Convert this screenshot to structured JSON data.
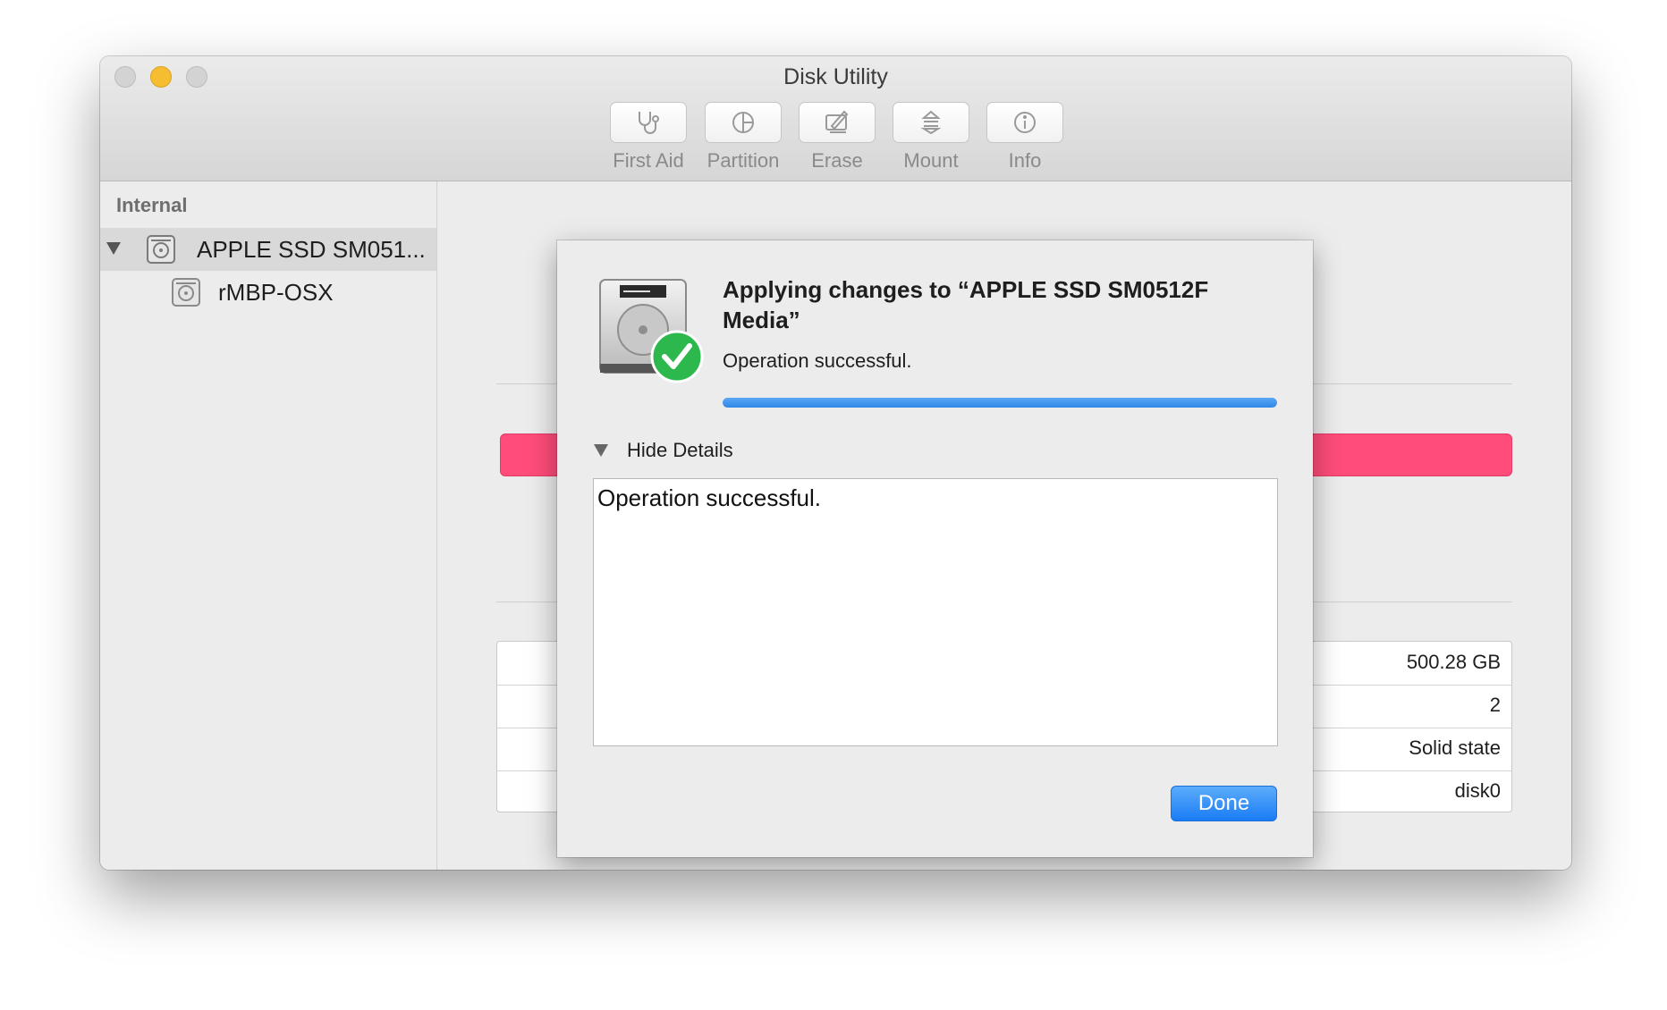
{
  "window": {
    "title": "Disk Utility"
  },
  "toolbar": {
    "items": [
      {
        "label": "First Aid",
        "icon": "stethoscope-icon"
      },
      {
        "label": "Partition",
        "icon": "pie-chart-icon"
      },
      {
        "label": "Erase",
        "icon": "erase-icon"
      },
      {
        "label": "Mount",
        "icon": "mount-icon"
      },
      {
        "label": "Info",
        "icon": "info-icon"
      }
    ]
  },
  "sidebar": {
    "section": "Internal",
    "items": [
      {
        "label": "APPLE SSD SM051...",
        "icon": "hard-drive-icon",
        "selected": true
      },
      {
        "label": "rMBP-OSX",
        "icon": "volume-icon",
        "selected": false
      }
    ]
  },
  "main": {
    "usage_bar_color": "#ff4c7a",
    "info_values": [
      "500.28 GB",
      "2",
      "Solid state",
      "disk0"
    ]
  },
  "sheet": {
    "title": "Applying changes to “APPLE SSD SM0512F Media”",
    "status": "Operation successful.",
    "progress": 1.0,
    "details_toggle": "Hide Details",
    "details_text": "Operation successful.",
    "done_label": "Done",
    "accent_color": "#1a7cf5",
    "success_color": "#2db84d"
  }
}
